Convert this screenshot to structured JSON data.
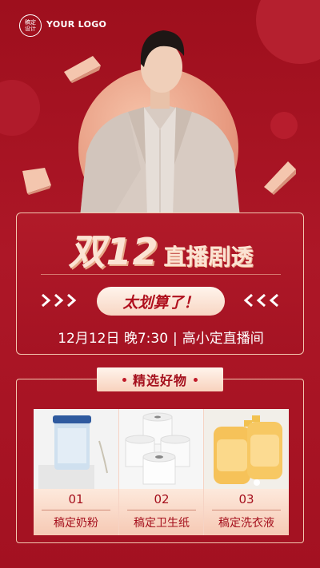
{
  "logo": {
    "badge_text": "稿定\n设计",
    "text": "YOUR LOGO"
  },
  "headline": {
    "big": "双12",
    "sub": "直播剧透"
  },
  "pill": {
    "label": "太划算了！"
  },
  "date": {
    "day": "12月12日 晚7:30",
    "separator": "|",
    "room": "高小定直播间"
  },
  "products_title": "精选好物",
  "products": [
    {
      "num": "01",
      "name": "稿定奶粉",
      "icon": "milk-powder-can-icon"
    },
    {
      "num": "02",
      "name": "稿定卫生纸",
      "icon": "toilet-paper-icon"
    },
    {
      "num": "03",
      "name": "稿定洗衣液",
      "icon": "laundry-detergent-icon"
    }
  ],
  "colors": {
    "background": "#a51321",
    "accent": "#fbe3d3",
    "text_dark": "#a5101d"
  }
}
